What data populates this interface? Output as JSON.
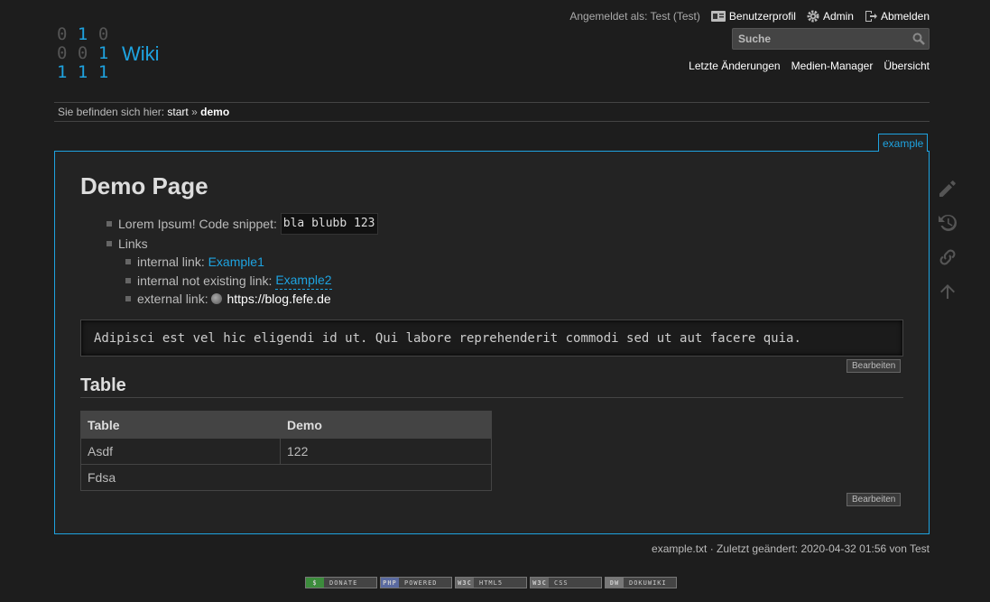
{
  "logo": {
    "rows": [
      [
        "0",
        "1",
        "0"
      ],
      [
        "0",
        "0",
        "1"
      ],
      [
        "1",
        "1",
        "1"
      ]
    ],
    "title": "Wiki"
  },
  "usertools": {
    "logged_in": "Angemeldet als: Test (Test)",
    "profile": "Benutzerprofil",
    "admin": "Admin",
    "logout": "Abmelden"
  },
  "search": {
    "placeholder": "Suche"
  },
  "sitetools": {
    "recent": "Letzte Änderungen",
    "media": "Medien-Manager",
    "index": "Übersicht"
  },
  "breadcrumb": {
    "prefix": "Sie befinden sich hier:",
    "start": "start",
    "sep": "»",
    "current": "demo"
  },
  "page": {
    "tab": "example",
    "title": "Demo Page",
    "item1_text": "Lorem Ipsum! Code snippet:",
    "item1_code": "bla blubb 123",
    "item2_text": "Links",
    "internal_label": "internal link:",
    "internal_link": "Example1",
    "wanted_label": "internal not existing link:",
    "wanted_link": "Example2",
    "external_label": "external link:",
    "external_link": "https://blog.fefe.de",
    "code_block": "Adipisci est vel hic eligendi id ut. Qui labore reprehenderit commodi sed ut aut facere quia.",
    "edit_label": "Bearbeiten",
    "section_title": "Table",
    "table": {
      "headers": [
        "Table",
        "Demo"
      ],
      "rows": [
        [
          "Asdf",
          "122"
        ],
        [
          "Fdsa",
          ""
        ]
      ]
    }
  },
  "docinfo": "example.txt · Zuletzt geändert: 2020-04-32 01:56 von Test",
  "badges": [
    {
      "icon": "$",
      "label": "DONATE",
      "color": "#3c8c3c"
    },
    {
      "icon": "PHP",
      "label": "POWERED",
      "color": "#5a6aa0"
    },
    {
      "icon": "W3C",
      "label": "HTML5",
      "color": "#666"
    },
    {
      "icon": "W3C",
      "label": "CSS",
      "color": "#666"
    },
    {
      "icon": "DW",
      "label": "DOKUWIKI",
      "color": "#777"
    }
  ],
  "colors": {
    "accent": "#1ea3e0",
    "background": "#1d1d1d",
    "panel": "#232323"
  }
}
